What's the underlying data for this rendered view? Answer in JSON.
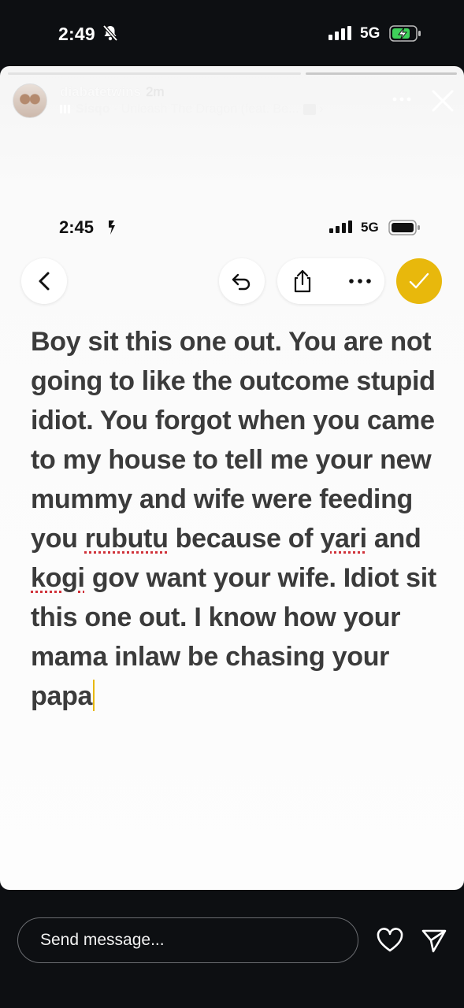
{
  "status_bar": {
    "time": "2:49",
    "network": "5G"
  },
  "story": {
    "username": "diabatetwins",
    "posted_ago": "2m",
    "music_artist": "Sisqo",
    "music_title": "Unleash The Dragon (feat. Be..."
  },
  "inner_screenshot": {
    "time": "2:45",
    "network": "5G",
    "note_text": {
      "before": "Boy sit this one out. You are not going to like the outcome stupid idiot. You forgot when you came to my house to tell me your new mummy and wife were feeding you ",
      "word1": "rubutu",
      "mid1": " because of ",
      "word2": "yari",
      "mid2": " and ",
      "word3": "kogi",
      "after": " gov want your wife. Idiot sit this one out. I know how your mama inlaw be chasing your papa"
    }
  },
  "bottom_bar": {
    "message_placeholder": "Send message..."
  }
}
